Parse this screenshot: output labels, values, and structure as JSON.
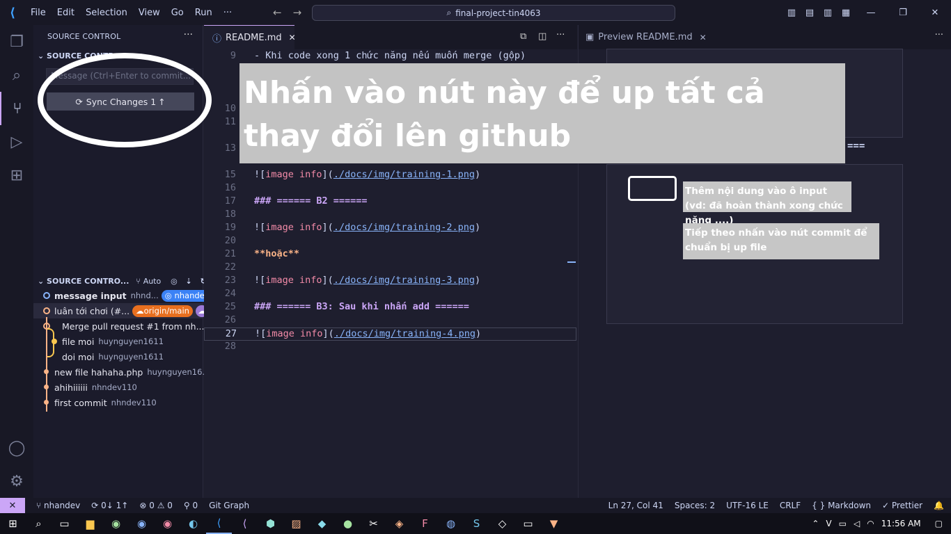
{
  "titlebar": {
    "menu": [
      "File",
      "Edit",
      "Selection",
      "View",
      "Go",
      "Run",
      "···"
    ],
    "search": "final-project-tin4063"
  },
  "sidebar": {
    "header": "SOURCE CONTROL",
    "section1": "SOURCE CONTR",
    "message_placeholder": "Message (Ctrl+Enter to commit...",
    "sync_button": "Sync Changes 1",
    "section2": "SOURCE CONTRO...",
    "auto_label": "Auto",
    "graph": [
      {
        "msg": "message input",
        "author": "nhnd...",
        "badge": "nhandev"
      },
      {
        "msg": "luân tới chơi (#...",
        "author": "",
        "badge": "origin/main"
      },
      {
        "msg": "Merge pull request #1 from nh...",
        "author": ""
      },
      {
        "msg": "file moi",
        "author": "huynguyen1611"
      },
      {
        "msg": "doi moi",
        "author": "huynguyen1611"
      },
      {
        "msg": "new file hahaha.php",
        "author": "huynguyen16..."
      },
      {
        "msg": "ahihiiiiii",
        "author": "nhndev110"
      },
      {
        "msg": "first commit",
        "author": "nhndev110"
      }
    ]
  },
  "editor": {
    "tab": "README.md",
    "lines": [
      {
        "n": "9",
        "text": "- Khi code xong 1 chức năng nếu muốn merge (gộp)"
      },
      {
        "n": "10",
        "text": ""
      },
      {
        "n": "11",
        "text": ""
      },
      {
        "n": "13",
        "text": ""
      },
      {
        "n": "15",
        "img": "image info",
        "link": "./docs/img/training-1.png"
      },
      {
        "n": "16",
        "text": ""
      },
      {
        "n": "17",
        "h3": "### ====== B2 ======"
      },
      {
        "n": "18",
        "text": ""
      },
      {
        "n": "19",
        "img": "image info",
        "link": "./docs/img/training-2.png"
      },
      {
        "n": "20",
        "text": ""
      },
      {
        "n": "21",
        "bold": "**hoặc**"
      },
      {
        "n": "22",
        "text": ""
      },
      {
        "n": "23",
        "img": "image info",
        "link": "./docs/img/training-3.png"
      },
      {
        "n": "24",
        "text": ""
      },
      {
        "n": "25",
        "h3": "### ====== B3: Sau khi nhấn add ======"
      },
      {
        "n": "26",
        "text": ""
      },
      {
        "n": "27",
        "img": "image info",
        "link": "./docs/img/training-4.png"
      },
      {
        "n": "28",
        "text": ""
      }
    ]
  },
  "preview": {
    "tab": "Preview README.md",
    "callout1": "Thêm nội dung vào ô input (vd: đã hoàn thành xong chức năng ....)",
    "callout2": "Tiếp theo nhấn vào nút commit để chuẩn bị up file"
  },
  "overlay_text": "Nhấn vào nút này để up tất cả thay đổi lên github",
  "statusbar": {
    "branch": "nhandev",
    "sync": "0↓ 1↑",
    "problems": "⊗ 0 ⚠ 0",
    "ports": "0",
    "gitgraph": "Git Graph",
    "position": "Ln 27, Col 41",
    "spaces": "Spaces: 2",
    "encoding": "UTF-16 LE",
    "eol": "CRLF",
    "language": "Markdown",
    "prettier": "Prettier"
  },
  "taskbar": {
    "time": "11:56 AM"
  },
  "colors": {
    "accent": "#cba6f7",
    "orange": "#fab387",
    "blue": "#89b4fa"
  }
}
